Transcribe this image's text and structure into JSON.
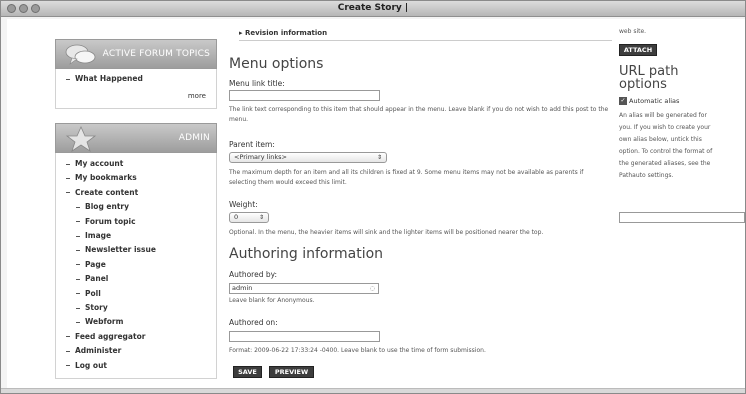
{
  "window": {
    "title": "Create Story |"
  },
  "sidebar": {
    "forum_block": {
      "title": "ACTIVE FORUM TOPICS",
      "items": [
        "What Happened"
      ],
      "more": "more"
    },
    "admin_block": {
      "title": "ADMIN",
      "items": [
        {
          "label": "My account",
          "level": 1
        },
        {
          "label": "My bookmarks",
          "level": 1
        },
        {
          "label": "Create content",
          "level": 1
        },
        {
          "label": "Blog entry",
          "level": 2
        },
        {
          "label": "Forum topic",
          "level": 2
        },
        {
          "label": "Image",
          "level": 2
        },
        {
          "label": "Newsletter issue",
          "level": 2
        },
        {
          "label": "Page",
          "level": 2
        },
        {
          "label": "Panel",
          "level": 2
        },
        {
          "label": "Poll",
          "level": 2
        },
        {
          "label": "Story",
          "level": 2
        },
        {
          "label": "Webform",
          "level": 2
        },
        {
          "label": "Feed aggregator",
          "level": 1
        },
        {
          "label": "Administer",
          "level": 1
        },
        {
          "label": "Log out",
          "level": 1
        }
      ]
    }
  },
  "main": {
    "revision_link": "Revision information",
    "menu": {
      "heading": "Menu options",
      "link_title_label": "Menu link title:",
      "link_title_value": "",
      "link_title_help": "The link text corresponding to this item that should appear in the menu. Leave blank if you do not wish to add this post to the menu.",
      "parent_label": "Parent item:",
      "parent_value": "<Primary links>",
      "parent_help": "The maximum depth for an item and all its children is fixed at 9. Some menu items may not be available as parents if selecting them would exceed this limit.",
      "weight_label": "Weight:",
      "weight_value": "0",
      "weight_help": "Optional. In the menu, the heavier items will sink and the lighter items will be positioned nearer the top."
    },
    "authoring": {
      "heading": "Authoring information",
      "authored_by_label": "Authored by:",
      "authored_by_value": "admin",
      "authored_by_help": "Leave blank for Anonymous.",
      "authored_on_label": "Authored on:",
      "authored_on_value": "",
      "authored_on_help": "Format: 2009-06-22 17:33:24 -0400. Leave blank to use the time of form submission."
    },
    "save_label": "SAVE",
    "preview_label": "PREVIEW"
  },
  "right": {
    "top_text": "web site.",
    "attach_label": "ATTACH",
    "url_heading": "URL path options",
    "automatic_alias_label": "Automatic alias",
    "automatic_alias_checked": true,
    "help": "An alias will be generated for you. If you wish to create your own alias below, untick this option. To control the format of the generated aliases, see the Pathauto settings.",
    "alias_value": ""
  }
}
